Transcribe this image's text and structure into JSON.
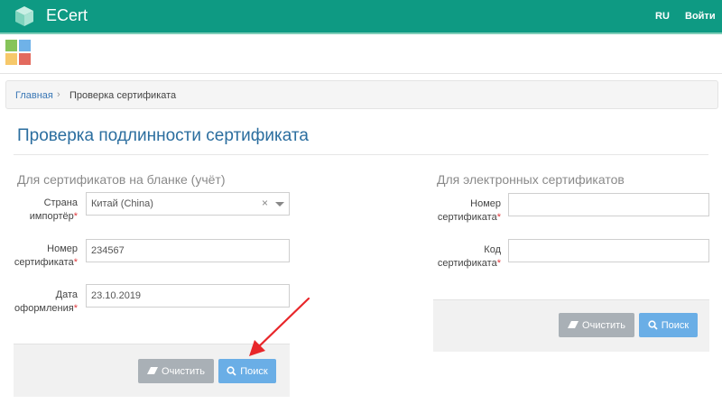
{
  "header": {
    "brand": "ECert",
    "lang": "RU",
    "login": "Войти",
    "accent": "#0e9a83"
  },
  "apps_icon": {
    "colors": [
      "#86c45a",
      "#6fb2e8",
      "#f6c86a",
      "#e36a5e"
    ]
  },
  "breadcrumb": {
    "home": "Главная",
    "separator": "›",
    "current": "Проверка сертификата"
  },
  "page": {
    "title": "Проверка подлинности сертификата"
  },
  "blank_form": {
    "title": "Для сертификатов на бланке (учёт)",
    "country": {
      "label_line1": "Страна",
      "label_line2": "импортёр",
      "value": "Китай (China)",
      "clear_icon": "×"
    },
    "number": {
      "label_line1": "Номер",
      "label_line2": "сертификата",
      "value": "234567"
    },
    "date": {
      "label_line1": "Дата",
      "label_line2": "оформления",
      "value": "23.10.2019"
    },
    "clear_label": "Очистить",
    "search_label": "Поиск"
  },
  "electronic_form": {
    "title": "Для электронных сертификатов",
    "number": {
      "label_line1": "Номер",
      "label_line2": "сертификата",
      "value": ""
    },
    "code": {
      "label_line1": "Код",
      "label_line2": "сертификата",
      "value": ""
    },
    "clear_label": "Очистить",
    "search_label": "Поиск"
  },
  "required_mark": "*"
}
